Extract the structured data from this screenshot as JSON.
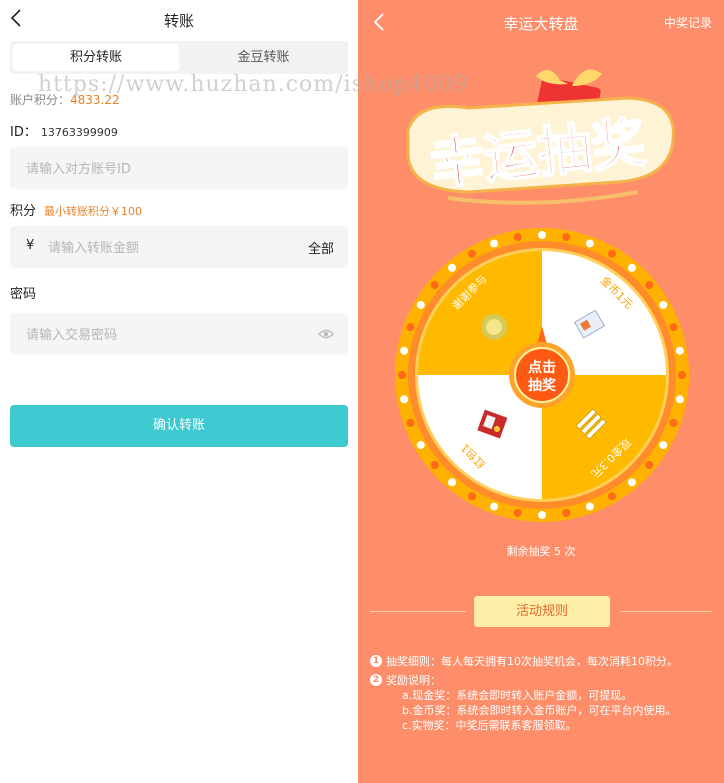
{
  "transfer": {
    "title": "转账",
    "tabs": [
      {
        "label": "积分转账",
        "active": true
      },
      {
        "label": "金豆转账",
        "active": false
      }
    ],
    "balance_label": "账户积分：",
    "balance_value": "4833.22",
    "id_label": "ID：",
    "id_value": "13763399909",
    "account_placeholder": "请输入对方账号ID",
    "points_label": "积分",
    "min_note": "最小转账积分￥100",
    "currency_symbol": "¥",
    "amount_placeholder": "请输入转账金额",
    "all_label": "全部",
    "password_label": "密码",
    "password_placeholder": "请输入交易密码",
    "confirm_label": "确认转账"
  },
  "watermark": "https://www.huzhan.com/ishop4009",
  "lottery": {
    "title": "幸运大转盘",
    "records_label": "中奖记录",
    "banner_text": "幸运抽奖",
    "spin_label_line1": "点击",
    "spin_label_line2": "抽奖",
    "prizes": [
      "谢谢参与",
      "金币1元",
      "现金0.3元",
      "红包1"
    ],
    "remaining": "剩余抽奖 5 次",
    "rules_button": "活动规则",
    "notes": [
      {
        "num": "1",
        "text": "抽奖细则：每人每天拥有10次抽奖机会，每次消耗10积分。"
      },
      {
        "num": "2",
        "text": "奖励说明：",
        "items": [
          "a.现金奖：系统会即时转入账户金额，可提现。",
          "b.金币奖：系统会即时转入金币账户，可在平台内使用。",
          "c.实物奖：中奖后需联系客服领取。"
        ]
      }
    ]
  },
  "colors": {
    "accent": "#3ec9d0",
    "lottery_bg": "#fe8e6a",
    "wheel_yellow": "#ffba00",
    "ring_orange": "#ff8a00",
    "spin_red": "#ff5a14",
    "rules_bg": "#fdeea8",
    "highlight_orange": "#e8822a"
  },
  "icons": {
    "back": "chevron-left-icon",
    "eye": "eye-icon",
    "note": "numbered-circle-icon"
  }
}
